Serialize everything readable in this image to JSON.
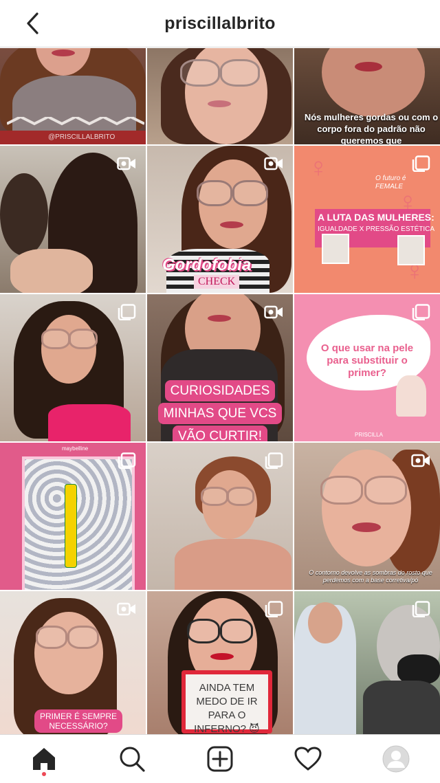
{
  "header": {
    "title": "priscillalbrito"
  },
  "colors": {
    "accent_pink": "#e24a87",
    "notification": "#ed4956",
    "icon_dark": "#262626"
  },
  "grid": {
    "watermark_1": "@PRISCILLALBRITO",
    "cell3_text": "Nós mulheres gordas ou com o corpo fora do padrão não queremos que",
    "cell5_title": "Gordofobia",
    "cell5_sub": "CHECK",
    "cell6_brand": "O futuro é FEMALE",
    "cell6_title": "A LUTA DAS MULHERES:",
    "cell6_sub": "IGUALDADE X PRESSÃO ESTÉTICA",
    "cell8_lines": [
      "CURIOSIDADES",
      "MINHAS QUE VCS",
      "VÃO CURTIR!"
    ],
    "cell9_text": "O que usar na pele para substituir o primer?",
    "cell9_footer": "PRISCILLA",
    "cell10_brand": "maybelline",
    "cell12_caption": "O contorno devolve as sombras do rosto que perdemos com a base corretiva/pó",
    "cell13_lines": [
      "PRIMER É SEMPRE",
      "NECESSÁRIO?"
    ],
    "cell14_sign": "AINDA TEM MEDO DE IR PARA O INFERNO? 😈"
  },
  "icons": {
    "back": "chevron-left-icon",
    "video": "video-camera-icon",
    "carousel": "multiple-posts-icon",
    "home": "home-icon",
    "search": "search-icon",
    "add": "add-post-icon",
    "activity": "heart-icon",
    "profile": "avatar-icon"
  }
}
